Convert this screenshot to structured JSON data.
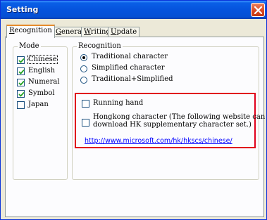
{
  "window": {
    "title": "Setting",
    "close_icon": "close-icon"
  },
  "tabs": [
    {
      "label_pre": "",
      "label_ul": "R",
      "label_post": "ecognition"
    },
    {
      "label_pre": "",
      "label_ul": "G",
      "label_post": "eneral"
    },
    {
      "label_pre": "",
      "label_ul": "W",
      "label_post": "riting"
    },
    {
      "label_pre": "",
      "label_ul": "U",
      "label_post": "pdate"
    }
  ],
  "mode": {
    "label": "Mode",
    "items": [
      {
        "label": "Chinese",
        "checked": true
      },
      {
        "label": "English",
        "checked": true
      },
      {
        "label": "Numeral",
        "checked": true
      },
      {
        "label": "Symbol",
        "checked": true
      },
      {
        "label": "Japan",
        "checked": false
      }
    ]
  },
  "recognition": {
    "label": "Recognition",
    "radios": [
      {
        "label": "Traditional character",
        "selected": true
      },
      {
        "label": "Simplified character",
        "selected": false
      },
      {
        "label": "Traditional+Simplified",
        "selected": false
      }
    ],
    "running_hand": {
      "label": "Running hand",
      "checked": false
    },
    "hongkong": {
      "label_line1": "Hongkong character (The following website can",
      "label_line2": "download HK supplementary character set.)",
      "checked": false
    },
    "link": "http://www.microsoft.com/hk/hkscs/chinese/"
  },
  "colors": {
    "highlight_box": "#e0001b",
    "link": "#0000ff",
    "titlebar": "#0553dd"
  }
}
